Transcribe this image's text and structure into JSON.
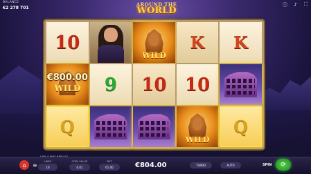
{
  "balance": {
    "label": "BALANCE",
    "value": "€2 278 701"
  },
  "logo": {
    "line1": "AROUND THE",
    "line2": "WORLD"
  },
  "reels": [
    [
      {
        "sym": "10",
        "type": "num"
      },
      {
        "sym": "€800.00",
        "type": "wild-amount",
        "label": "WILD",
        "win": true
      },
      {
        "sym": "Q",
        "type": "q",
        "win": true
      }
    ],
    [
      {
        "sym": "",
        "type": "woman"
      },
      {
        "sym": "9",
        "type": "nine"
      },
      {
        "sym": "",
        "type": "colosseum",
        "win": true
      }
    ],
    [
      {
        "sym": "WILD",
        "type": "wild",
        "win": true
      },
      {
        "sym": "10",
        "type": "num"
      },
      {
        "sym": "",
        "type": "colosseum",
        "win": true
      }
    ],
    [
      {
        "sym": "K",
        "type": "k"
      },
      {
        "sym": "10",
        "type": "num"
      },
      {
        "sym": "WILD",
        "type": "wild",
        "win": true
      }
    ],
    [
      {
        "sym": "K",
        "type": "k"
      },
      {
        "sym": "",
        "type": "colosseum",
        "win": true
      },
      {
        "sym": "Q",
        "type": "q",
        "win": true
      }
    ]
  ],
  "payline_info": "LINE 4 PAYS €800.00",
  "controls": {
    "lines": {
      "label": "LINES",
      "value": "10"
    },
    "coin_value": {
      "label": "COIN VALUE",
      "value": "0.01"
    },
    "bet": {
      "label": "BET",
      "value": "€1.00"
    }
  },
  "win_amount": "€804.00",
  "turbo_label": "TURBO",
  "auto_label": "AUTO",
  "spin_label": "SPIN"
}
